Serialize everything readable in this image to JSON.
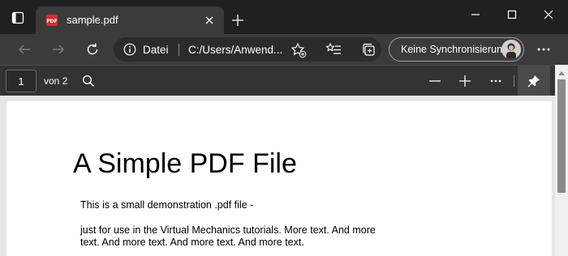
{
  "tab": {
    "title": "sample.pdf"
  },
  "address": {
    "scheme_label": "Datei",
    "url": "C:/Users/Anwend..."
  },
  "sync": {
    "label": "Keine Synchronisierung"
  },
  "pdf_toolbar": {
    "page_number": "1",
    "page_count_label": "von 2"
  },
  "document": {
    "title": "A Simple PDF File",
    "lines": [
      "This is a small demonstration .pdf file -",
      "just for use in the Virtual Mechanics tutorials. More text. And more",
      "text. And more text. And more text. And more text."
    ]
  },
  "colors": {
    "tab_bg": "#3b3b3b",
    "chrome_bg": "#202020",
    "pdf_bar_bg": "#333333",
    "pdf_icon_red": "#d32f2f"
  }
}
